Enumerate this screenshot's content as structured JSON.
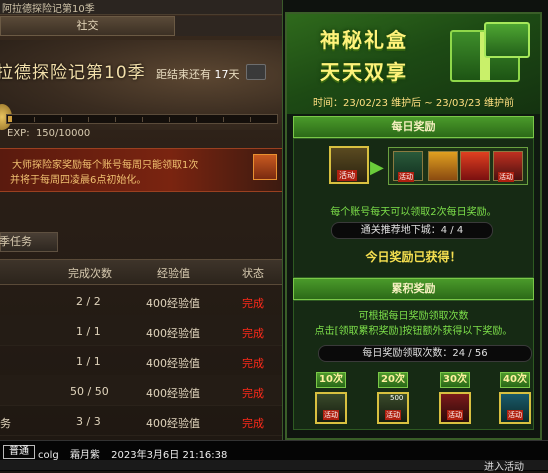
{
  "window": {
    "title": "阿拉德探险记第10季"
  },
  "tabs": [
    {
      "label": "社交"
    }
  ],
  "season": {
    "title": "拉德探险记第10季",
    "countdown_prefix": "距结束还有",
    "countdown_value": "17",
    "countdown_unit": "天",
    "exp_label": "EXP:",
    "exp_value": "150",
    "exp_max": "/10000",
    "exp_fraction": 0.015
  },
  "notice": {
    "line1": "大师探险家奖励每个账号每周只能领取1次",
    "line2": "并将于每周四凌晨6点初始化。"
  },
  "mission_tab": {
    "label": "季任务"
  },
  "table": {
    "headers": [
      "完成次数",
      "经验值",
      "状态"
    ],
    "rows": [
      {
        "count": "2 / 2",
        "exp": "400经验值",
        "status": "完成"
      },
      {
        "count": "1 / 1",
        "exp": "400经验值",
        "status": "完成"
      },
      {
        "count": "1 / 1",
        "exp": "400经验值",
        "status": "完成"
      },
      {
        "count": "50 / 50",
        "exp": "400经验值",
        "status": "完成"
      },
      {
        "count": "3 / 3",
        "exp": "400经验值",
        "status": "完成"
      }
    ],
    "last_row_prefix": "务"
  },
  "event": {
    "title_line1": "神秘礼盒",
    "title_line2": "天天双享",
    "time": "时间：23/02/23 维护后 ~ 23/03/23 维护前",
    "daily": {
      "header": "每日奖励",
      "tag": "活动",
      "info": "每个账号每天可以领取2次每日奖励。",
      "dungeon": "通关推荐地下城：4 / 4",
      "status": "今日奖励已获得！"
    },
    "cumulative": {
      "header": "累积奖励",
      "info_line1": "可根据每日奖励领取次数",
      "info_line2": "点击[领取累积奖励]按钮额外获得以下奖励。",
      "progress": "每日奖励领取次数：24 / 56",
      "tiers": [
        {
          "label": "10次"
        },
        {
          "label": "20次",
          "badge": "500"
        },
        {
          "label": "30次"
        },
        {
          "label": "40次"
        }
      ]
    }
  },
  "chat": {
    "mode": "普通",
    "user": "colg",
    "name": "霜月紫",
    "time": "2023年3月6日 21:16:38",
    "tail": "进入活动"
  },
  "colors": {
    "accent_green": "#7de04a",
    "done_red": "#ff2a1a",
    "title_yellow": "#fff37a"
  }
}
